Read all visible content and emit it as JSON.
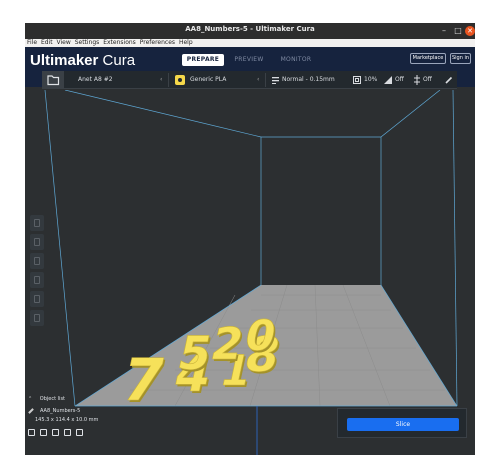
{
  "window": {
    "title": "AA8_Numbers-5 - Ultimaker Cura"
  },
  "menu": [
    "File",
    "Edit",
    "View",
    "Settings",
    "Extensions",
    "Preferences",
    "Help"
  ],
  "header": {
    "brand_bold": "Ultimaker",
    "brand_light": " Cura",
    "tabs": [
      "PREPARE",
      "PREVIEW",
      "MONITOR"
    ],
    "active_tab": "PREPARE",
    "marketplace": "Marketplace",
    "sign_in": "Sign in"
  },
  "toolbar": {
    "printer": "Anet A8 #2",
    "material": "Generic PLA",
    "profile": "Normal - 0.15mm",
    "infill": "10%",
    "support": "Off",
    "adhesion": "Off"
  },
  "object_list": {
    "title": "Object list",
    "name": "AA8_Numbers-5",
    "dimensions": "145.3 x 114.4 x 10.0 mm"
  },
  "slice": {
    "label": "Slice"
  },
  "model": {
    "digits": [
      "5",
      "2",
      "0",
      "7",
      "4",
      "1",
      "8"
    ],
    "color": "#f6e15a"
  },
  "colors": {
    "header": "#16233e",
    "accent": "#196ef0",
    "build_plate": "#9b9b9b"
  }
}
